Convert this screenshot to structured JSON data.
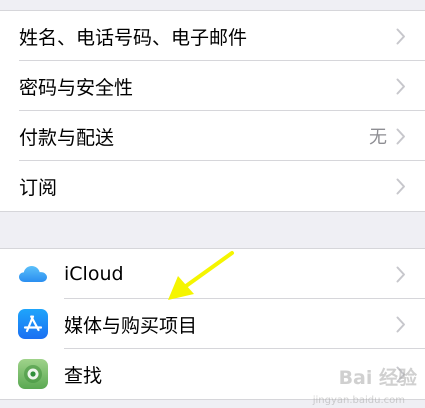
{
  "group1": {
    "rows": [
      {
        "label": "姓名、电话号码、电子邮件"
      },
      {
        "label": "密码与安全性"
      },
      {
        "label": "付款与配送",
        "value": "无"
      },
      {
        "label": "订阅"
      }
    ]
  },
  "group2": {
    "rows": [
      {
        "label": "iCloud",
        "icon": "icloud-icon"
      },
      {
        "label": "媒体与购买项目",
        "icon": "app-store-icon"
      },
      {
        "label": "查找",
        "icon": "find-my-icon"
      }
    ]
  },
  "annotation": {
    "color": "#f5f500",
    "icon": "yellow-arrow-icon"
  },
  "watermark": {
    "text": "Bai 经验",
    "subtext": "jingyan.baidu.com"
  },
  "colors": {
    "background": "#efeff4",
    "row": "#ffffff",
    "chevron": "#c7c7cc",
    "value_text": "#8e8e93"
  }
}
